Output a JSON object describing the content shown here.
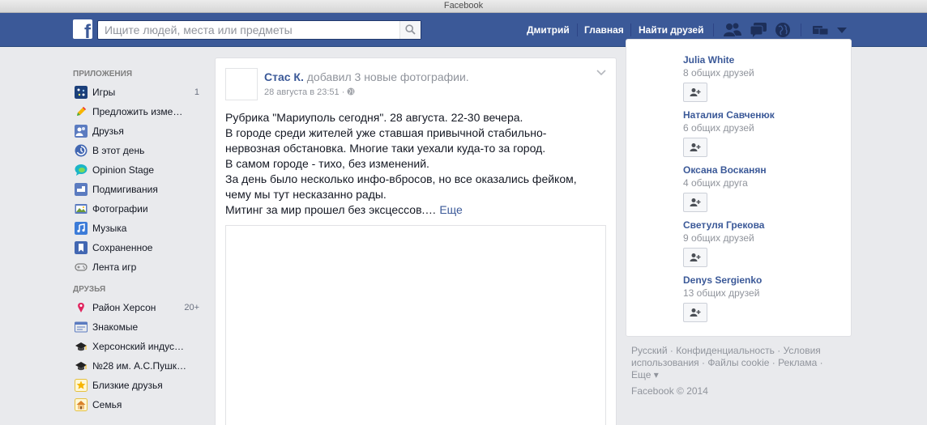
{
  "window": {
    "title": "Facebook"
  },
  "topbar": {
    "search_placeholder": "Ищите людей, места или предметы",
    "user": "Дмитрий",
    "home": "Главная",
    "find_friends": "Найти друзей"
  },
  "sidebar": {
    "apps_header": "ПРИЛОЖЕНИЯ",
    "apps": [
      {
        "label": "Игры",
        "count": "1",
        "icon": "games-icon"
      },
      {
        "label": "Предложить изме…",
        "icon": "pencil-icon"
      },
      {
        "label": "Друзья",
        "icon": "friends-icon"
      },
      {
        "label": "В этот день",
        "icon": "on-this-day-icon"
      },
      {
        "label": "Opinion Stage",
        "icon": "opinion-stage-icon"
      },
      {
        "label": "Подмигивания",
        "icon": "pokes-icon"
      },
      {
        "label": "Фотографии",
        "icon": "photos-icon"
      },
      {
        "label": "Музыка",
        "icon": "music-icon"
      },
      {
        "label": "Сохраненное",
        "icon": "saved-icon"
      },
      {
        "label": "Лента игр",
        "icon": "game-feed-icon"
      }
    ],
    "friends_header": "ДРУЗЬЯ",
    "friends": [
      {
        "label": "Район Херсон",
        "count": "20+",
        "icon": "location-pin-icon"
      },
      {
        "label": "Знакомые",
        "icon": "acquaintances-icon"
      },
      {
        "label": "Херсонский индус…",
        "icon": "graduation-cap-icon"
      },
      {
        "label": "№28 им. А.С.Пушк…",
        "icon": "graduation-cap-icon"
      },
      {
        "label": "Близкие друзья",
        "icon": "star-icon"
      },
      {
        "label": "Семья",
        "icon": "house-icon"
      }
    ]
  },
  "post": {
    "author": "Стас К.",
    "action": " добавил 3 новые фотографии.",
    "time": "28 августа в 23:51 · ",
    "lines": [
      "Рубрика \"Мариуполь сегодня\". 28 августа. 22-30 вечера.",
      "В городе среди жителей уже ставшая привычной стабильно-",
      "нервозная обстановка. Многие таки уехали куда-то за город.",
      "В самом городе - тихо, без изменений.",
      "За день было несколько инфо-вбросов, но все оказались фейком,",
      "чему мы тут несказанно рады.",
      "Митинг за мир прошел без эксцессов.…"
    ],
    "more": "Еще"
  },
  "suggestions": [
    {
      "name": "Julia White",
      "mutual": "8 общих друзей"
    },
    {
      "name": "Наталия Савченюк",
      "mutual": "6 общих друзей"
    },
    {
      "name": "Оксана Восканян",
      "mutual": "4 общих друга"
    },
    {
      "name": "Светуля Грекова",
      "mutual": "9 общих друзей"
    },
    {
      "name": "Denys Sergienko",
      "mutual": "13 общих друзей"
    }
  ],
  "footer": {
    "line1": "Русский · Конфиденциальность · Условия",
    "line2": "использования · Файлы cookie · Реклама ·",
    "line3": "Еще ▾",
    "copyright": "Facebook © 2014"
  },
  "colors": {
    "brand_blue": "#3b5998",
    "link": "#3b5998",
    "background": "#e9eaed"
  }
}
